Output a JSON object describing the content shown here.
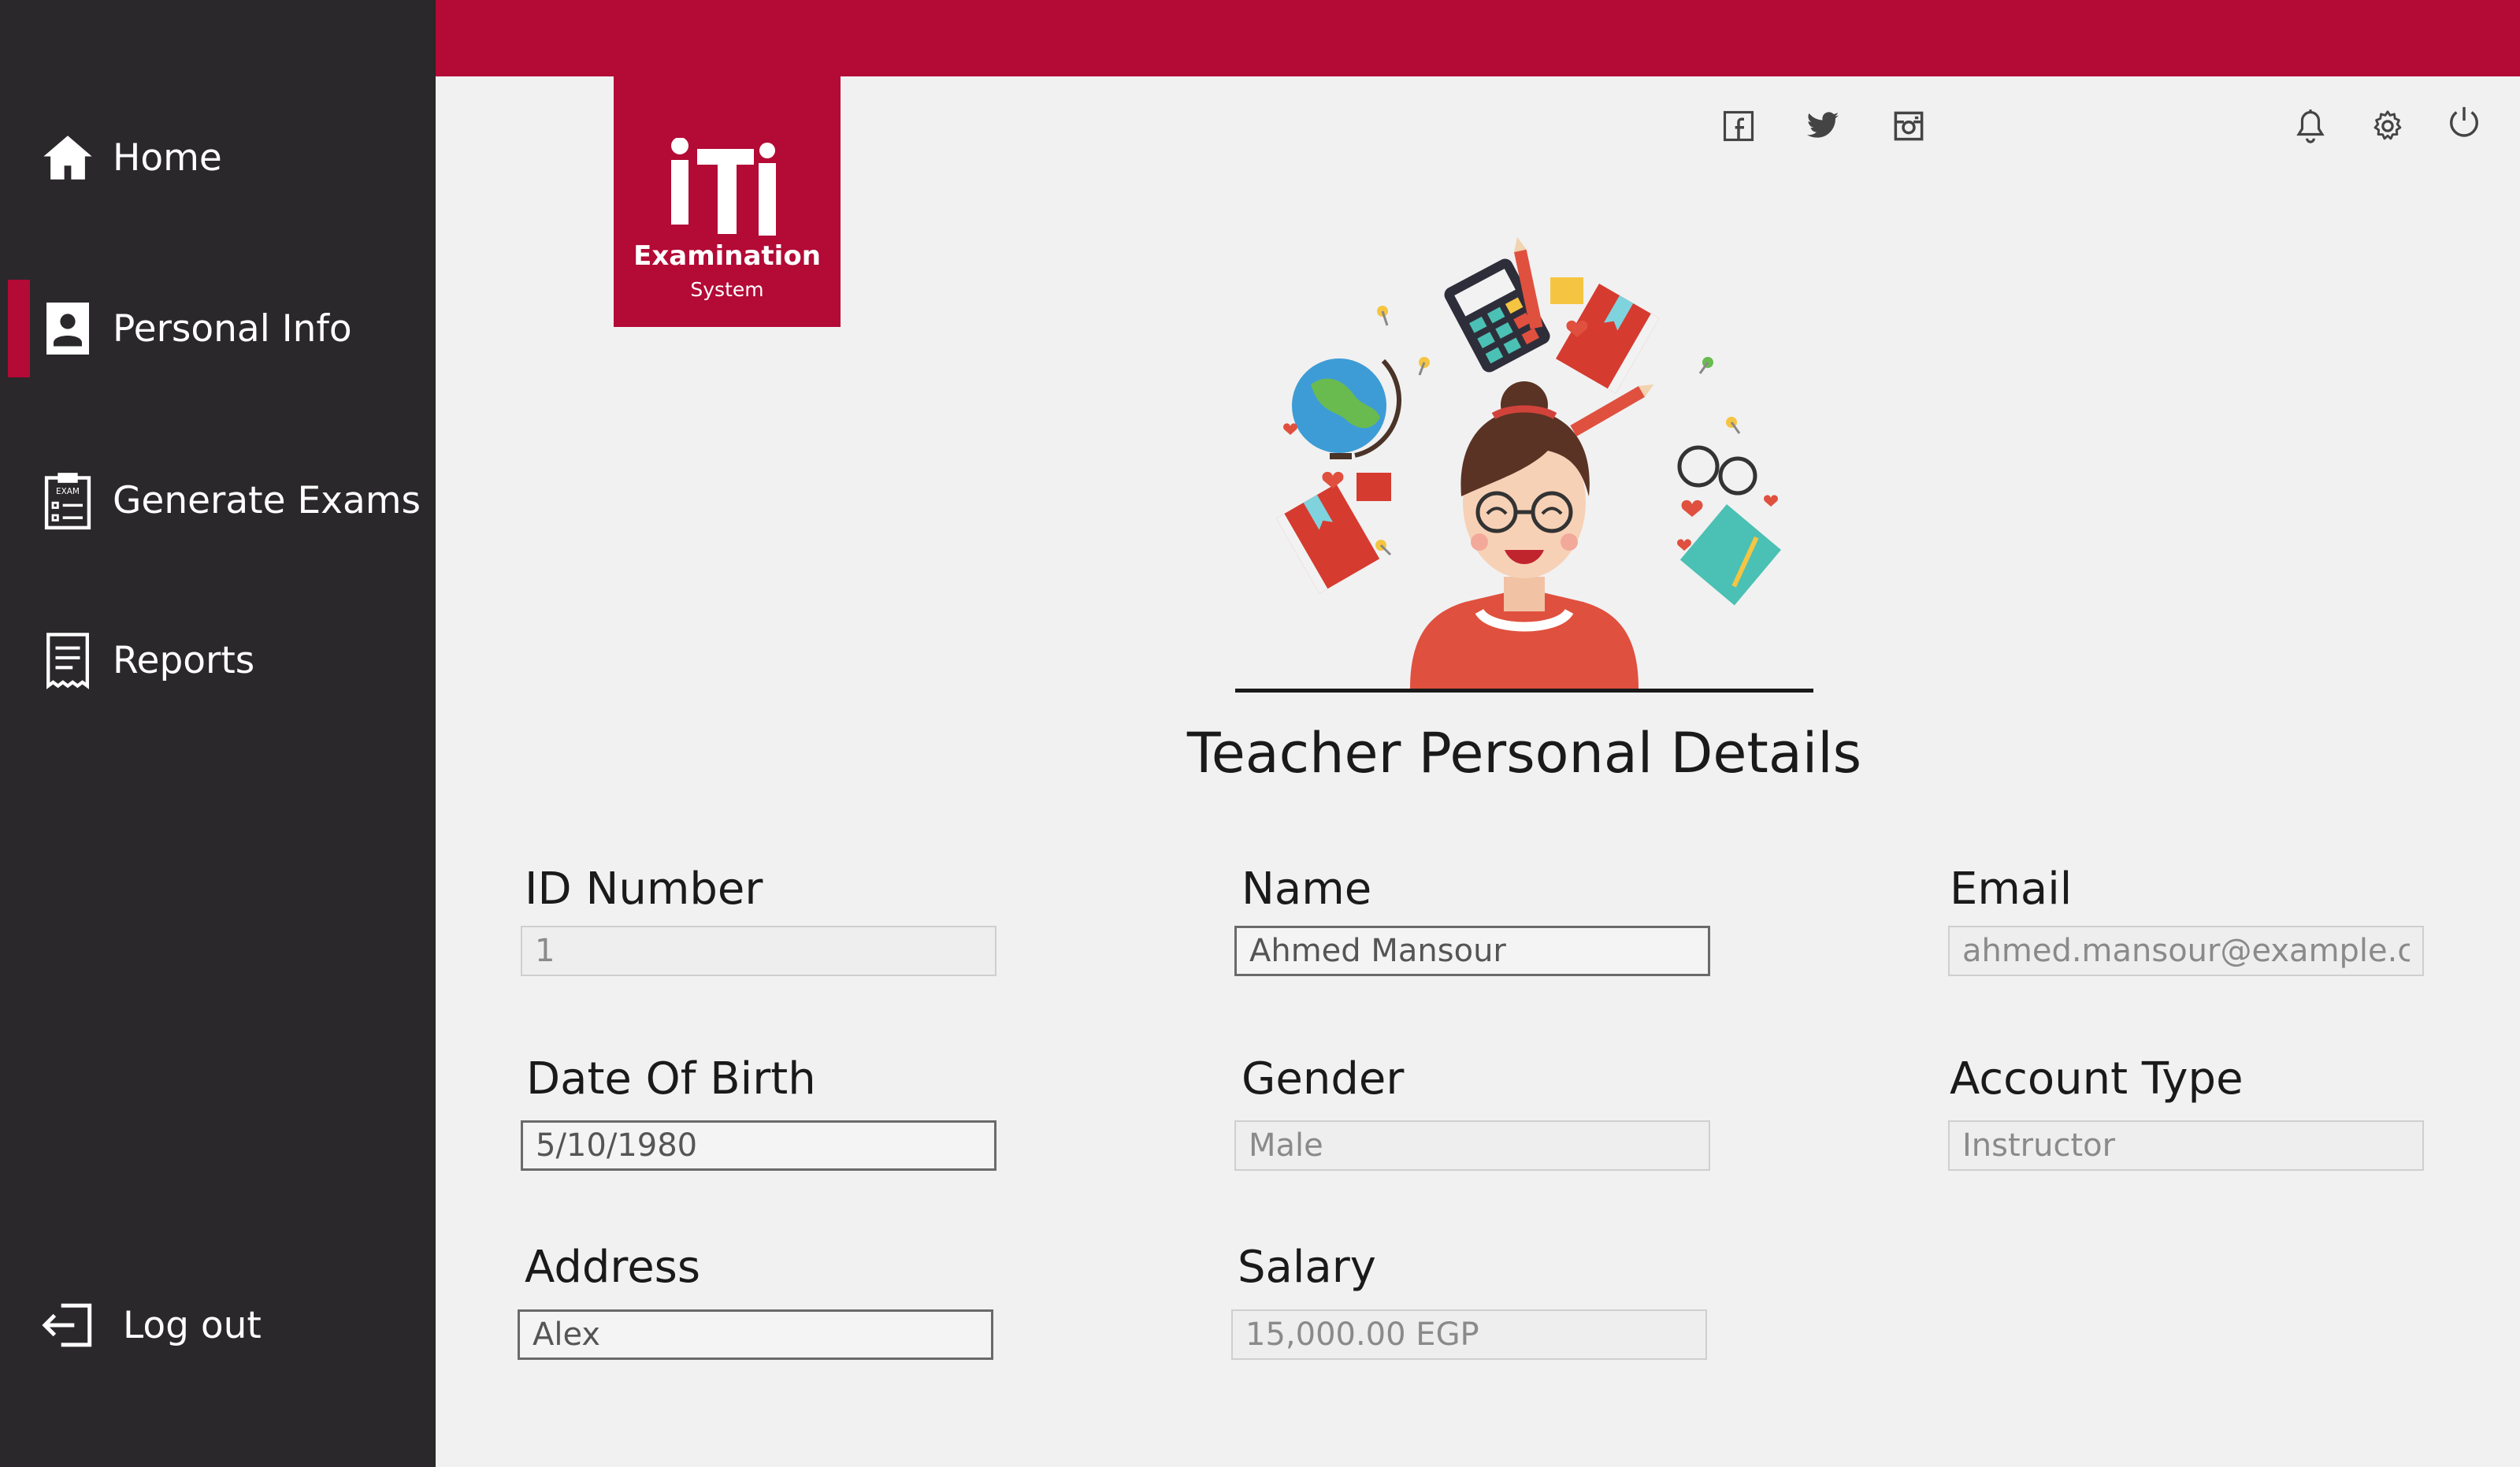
{
  "sidebar": {
    "items": [
      {
        "label": "Home",
        "icon": "home-icon"
      },
      {
        "label": "Personal Info",
        "icon": "id-card-icon",
        "active": true
      },
      {
        "label": "Generate Exams",
        "icon": "exam-clipboard-icon"
      },
      {
        "label": "Reports",
        "icon": "report-icon"
      }
    ],
    "logout_label": "Log out"
  },
  "logo": {
    "line1": "Examination",
    "line2": "System"
  },
  "header_icons": [
    "facebook-icon",
    "twitter-icon",
    "instagram-icon",
    "bell-icon",
    "gear-icon",
    "power-icon"
  ],
  "colors": {
    "brand": "#b30a36",
    "sidebar_bg": "#2a282a",
    "page_bg": "#f1f1f1"
  },
  "page_title": "Teacher Personal Details",
  "form": {
    "id_number": {
      "label": "ID Number",
      "value": "1"
    },
    "name": {
      "label": "Name",
      "value": "Ahmed Mansour"
    },
    "email": {
      "label": "Email",
      "value": "ahmed.mansour@example.c"
    },
    "dob": {
      "label": "Date Of Birth",
      "value": "5/10/1980"
    },
    "gender": {
      "label": "Gender",
      "value": "Male"
    },
    "account_type": {
      "label": "Account Type",
      "value": "Instructor"
    },
    "address": {
      "label": "Address",
      "value": "Alex"
    },
    "salary": {
      "label": "Salary",
      "value": "15,000.00 EGP"
    }
  }
}
